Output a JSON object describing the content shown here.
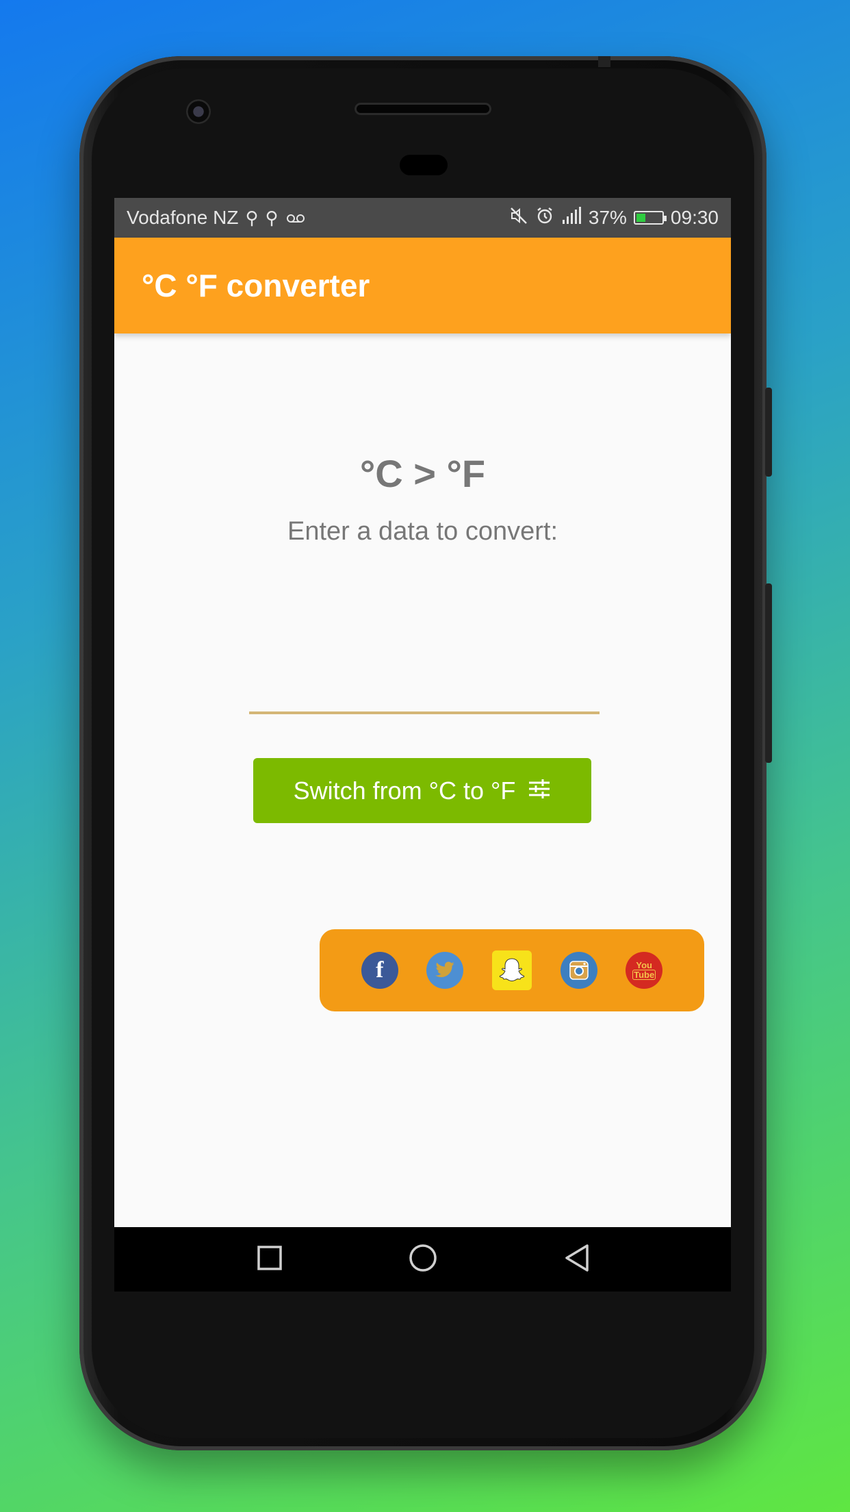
{
  "statusbar": {
    "carrier": "Vodafone NZ",
    "battery_percent": "37%",
    "battery_level": 0.37,
    "time": "09:30"
  },
  "appbar": {
    "title": "°C °F converter"
  },
  "converter": {
    "mode_heading": "°C > °F",
    "prompt": "Enter a data to convert:",
    "input_value": "",
    "switch_label": "Switch from °C to °F"
  },
  "social": {
    "items": [
      {
        "name": "facebook",
        "icon": "facebook-icon",
        "glyph": "f"
      },
      {
        "name": "twitter",
        "icon": "twitter-icon"
      },
      {
        "name": "snapchat",
        "icon": "snapchat-icon"
      },
      {
        "name": "instagram",
        "icon": "instagram-icon"
      },
      {
        "name": "youtube",
        "icon": "youtube-icon",
        "glyph_top": "You",
        "glyph_bottom": "Tube"
      }
    ]
  },
  "colors": {
    "appbar": "#fea11e",
    "switch_button": "#7cba00",
    "social_bar": "#f39b15",
    "input_underline": "#d4b676"
  }
}
